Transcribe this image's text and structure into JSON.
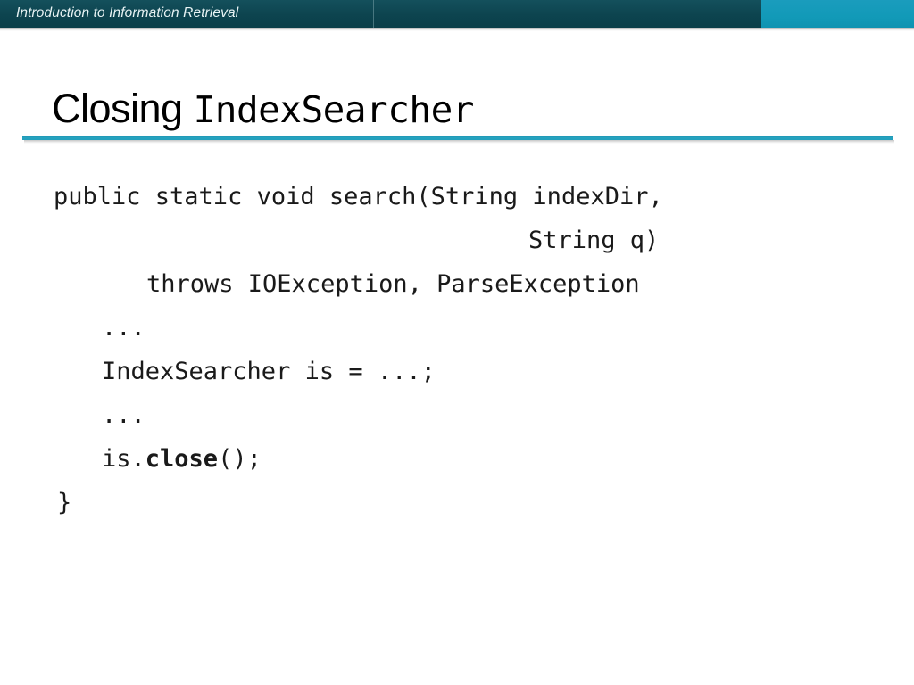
{
  "banner": {
    "title": "Introduction to Information Retrieval",
    "dark_color": "#0d444f",
    "accent_color": "#129ab8"
  },
  "slide": {
    "title_plain": "Closing ",
    "title_mono": "IndexSearcher",
    "rule_color": "#22a0bd"
  },
  "code": {
    "lines": [
      {
        "text": "public static void search(String indexDir,",
        "indent": "sig"
      },
      {
        "text": "String q)",
        "indent": "param"
      },
      {
        "text": "throws IOException, ParseException",
        "indent": "throws"
      },
      {
        "text": "...",
        "indent": "body"
      },
      {
        "text": "IndexSearcher is = ...;",
        "indent": "body"
      },
      {
        "text": "...",
        "indent": "body"
      },
      {
        "pre": "is.",
        "bold": "close",
        "post": "();",
        "indent": "body"
      },
      {
        "text": "}",
        "indent": "brace"
      }
    ]
  }
}
